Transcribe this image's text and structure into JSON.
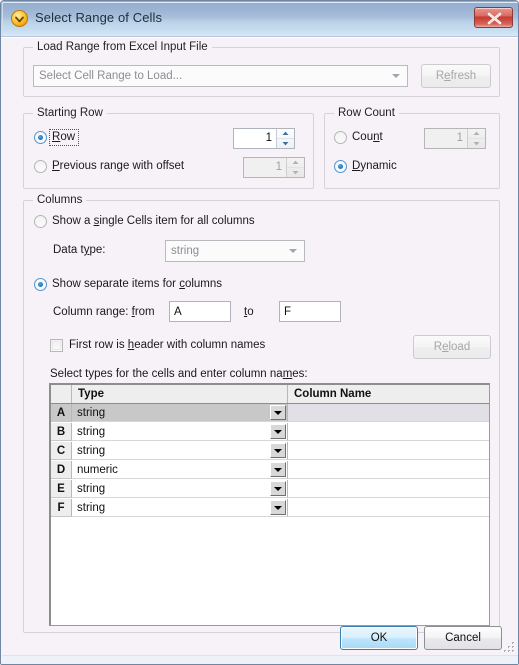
{
  "window": {
    "title": "Select Range of Cells",
    "app_icon": "chevron-circle-icon",
    "close_label": "x"
  },
  "load_range_group": {
    "title": "Load Range from Excel Input File",
    "combo": {
      "value": "Select Cell Range to Load...",
      "disabled": true
    },
    "refresh_button": {
      "label": "Refresh",
      "disabled": true
    }
  },
  "starting_row_group": {
    "title": "Starting Row",
    "options": [
      {
        "label": "Row",
        "underline": "R",
        "selected": true,
        "focused": true
      },
      {
        "label": "Previous range with offset",
        "underline": "P",
        "selected": false,
        "focused": false
      }
    ],
    "row_spinner": {
      "value": "1",
      "disabled": false
    },
    "offset_spinner": {
      "value": "1",
      "disabled": true
    }
  },
  "row_count_group": {
    "title": "Row Count",
    "options": [
      {
        "label": "Count",
        "underline": "n",
        "selected": false
      },
      {
        "label": "Dynamic",
        "underline": "D",
        "selected": true
      }
    ],
    "count_spinner": {
      "value": "1",
      "disabled": true
    }
  },
  "columns_group": {
    "title": "Columns",
    "single_item_radio": {
      "label": "Show a single Cells item for all columns",
      "selected": false
    },
    "data_type_label": "Data type:",
    "data_type_combo": {
      "value": "string",
      "disabled": true
    },
    "separate_items_radio": {
      "label": "Show separate items for columns",
      "selected": true
    },
    "column_range_label": "Column range: from",
    "column_from": "A",
    "column_to_label": "to",
    "column_to": "F",
    "header_checkbox": {
      "label": "First row is header with column names",
      "checked": false
    },
    "reload_button": {
      "label": "Reload",
      "disabled": true
    },
    "grid_caption": "Select types for the cells and enter column names:"
  },
  "grid": {
    "columns": [
      "",
      "Type",
      "Column Name"
    ],
    "rows": [
      {
        "row": "A",
        "type": "string",
        "name": "",
        "selected": true
      },
      {
        "row": "B",
        "type": "string",
        "name": "",
        "selected": false
      },
      {
        "row": "C",
        "type": "string",
        "name": "",
        "selected": false
      },
      {
        "row": "D",
        "type": "numeric",
        "name": "",
        "selected": false
      },
      {
        "row": "E",
        "type": "string",
        "name": "",
        "selected": false
      },
      {
        "row": "F",
        "type": "string",
        "name": "",
        "selected": false
      }
    ]
  },
  "footer": {
    "ok_button": "OK",
    "cancel_button": "Cancel"
  },
  "colors": {
    "dialog_background": "#f7f2f7",
    "titlebar_top": "#94add0",
    "titlebar_bottom": "#d9e9f6",
    "accent_blue": "#1a6fb4",
    "close_red": "#c7392f",
    "grid_selection": "#c8c8c8",
    "icon_orange": "#ffc83c"
  }
}
